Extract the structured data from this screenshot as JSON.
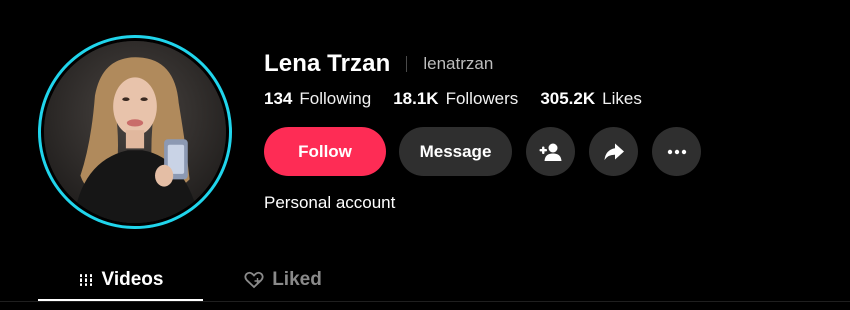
{
  "profile": {
    "display_name": "Lena Trzan",
    "username": "lenatrzan",
    "bio": "Personal account",
    "avatar_ring_color": "#20d5ec"
  },
  "stats": [
    {
      "value": "134",
      "label": "Following"
    },
    {
      "value": "18.1K",
      "label": "Followers"
    },
    {
      "value": "305.2K",
      "label": "Likes"
    }
  ],
  "actions": {
    "follow_label": "Follow",
    "follow_color": "#fe2c55",
    "message_label": "Message",
    "add_user_icon": "add-user-icon",
    "share_icon": "share-icon",
    "more_icon": "more-icon"
  },
  "tabs": [
    {
      "label": "Videos",
      "icon": "grid-icon",
      "active": true
    },
    {
      "label": "Liked",
      "icon": "heart-icon",
      "active": false
    }
  ]
}
